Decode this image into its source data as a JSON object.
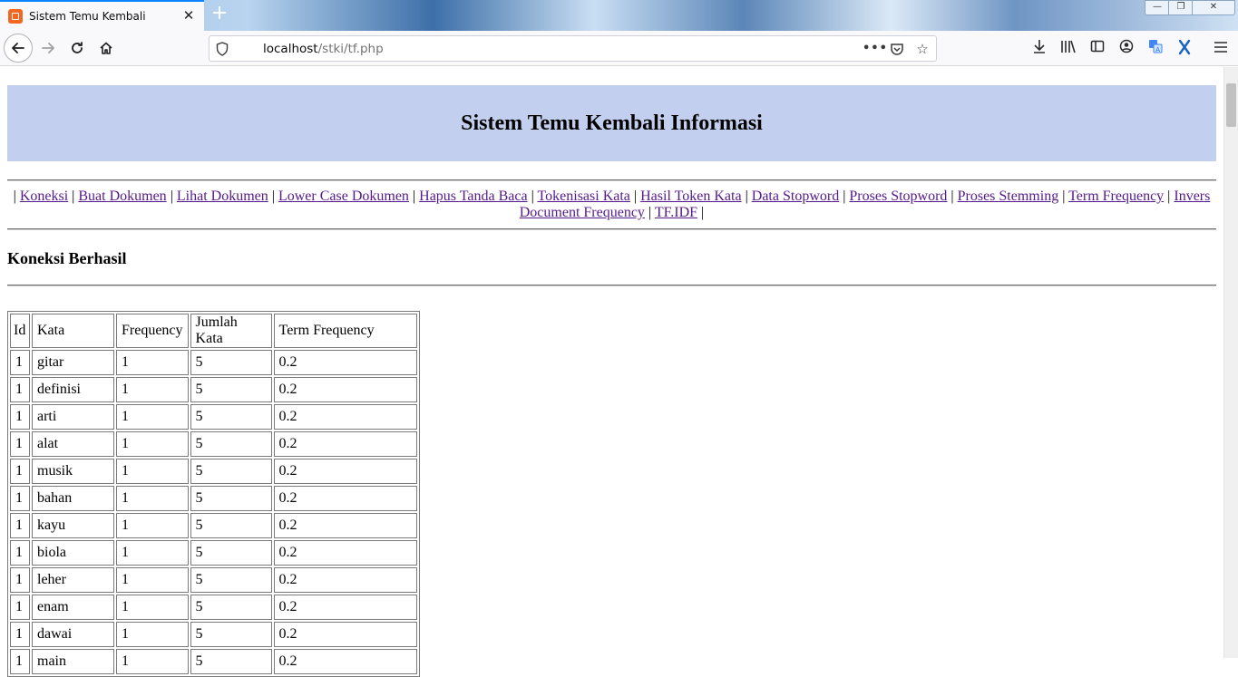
{
  "browser": {
    "tab_title": "Sistem Temu Kembali",
    "tab_close": "✕",
    "new_tab": "+",
    "url_host": "localhost",
    "url_path": "/stki/tf.php",
    "window_controls": {
      "minimize": "—",
      "maximize": "❐",
      "close": "✕"
    }
  },
  "page": {
    "heading": "Sistem Temu Kembali Informasi",
    "nav_links": [
      "Koneksi",
      "Buat Dokumen",
      "Lihat Dokumen",
      "Lower Case Dokumen",
      "Hapus Tanda Baca",
      "Tokenisasi Kata",
      "Hasil Token Kata",
      "Data Stopword",
      "Proses Stopword",
      "Proses Stemming",
      "Term Frequency",
      "Invers Document Frequency",
      "TF.IDF"
    ],
    "separator": "|",
    "status": "Koneksi Berhasil"
  },
  "table": {
    "headers": [
      "Id",
      "Kata",
      "Frequency",
      "Jumlah Kata",
      "Term Frequency"
    ],
    "rows": [
      [
        "1",
        "gitar",
        "1",
        "5",
        "0.2"
      ],
      [
        "1",
        "definisi",
        "1",
        "5",
        "0.2"
      ],
      [
        "1",
        "arti",
        "1",
        "5",
        "0.2"
      ],
      [
        "1",
        "alat",
        "1",
        "5",
        "0.2"
      ],
      [
        "1",
        "musik",
        "1",
        "5",
        "0.2"
      ],
      [
        "1",
        "bahan",
        "1",
        "5",
        "0.2"
      ],
      [
        "1",
        "kayu",
        "1",
        "5",
        "0.2"
      ],
      [
        "1",
        "biola",
        "1",
        "5",
        "0.2"
      ],
      [
        "1",
        "leher",
        "1",
        "5",
        "0.2"
      ],
      [
        "1",
        "enam",
        "1",
        "5",
        "0.2"
      ],
      [
        "1",
        "dawai",
        "1",
        "5",
        "0.2"
      ],
      [
        "1",
        "main",
        "1",
        "5",
        "0.2"
      ]
    ]
  },
  "colors": {
    "header_band": "#c3cfee",
    "visited_link": "#551a8b",
    "tab_accent": "#0a84ff"
  }
}
